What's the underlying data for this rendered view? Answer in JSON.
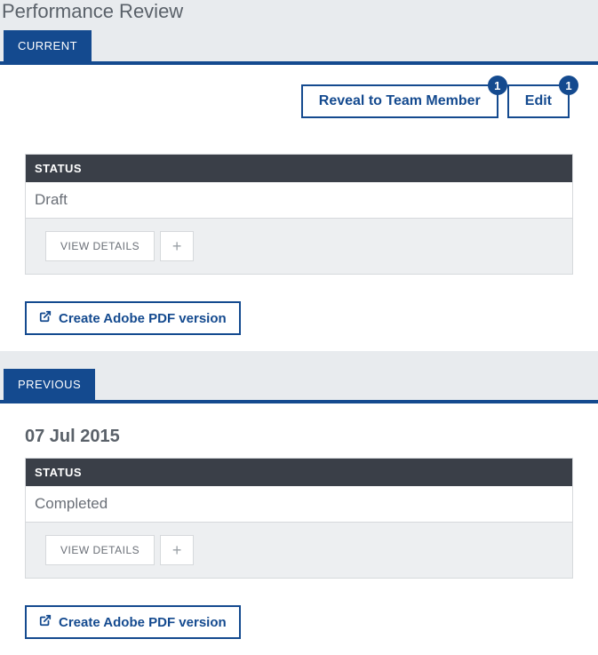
{
  "page_title": "Performance Review",
  "tabs": {
    "current": "CURRENT",
    "previous": "PREVIOUS"
  },
  "actions": {
    "reveal": {
      "label": "Reveal to Team Member",
      "badge": "1"
    },
    "edit": {
      "label": "Edit",
      "badge": "1"
    }
  },
  "status_header_label": "STATUS",
  "current": {
    "status": "Draft"
  },
  "previous": {
    "date": "07 Jul 2015",
    "status": "Completed"
  },
  "buttons": {
    "view_details": "VIEW DETAILS",
    "plus": "+",
    "create_pdf": "Create Adobe PDF version"
  }
}
